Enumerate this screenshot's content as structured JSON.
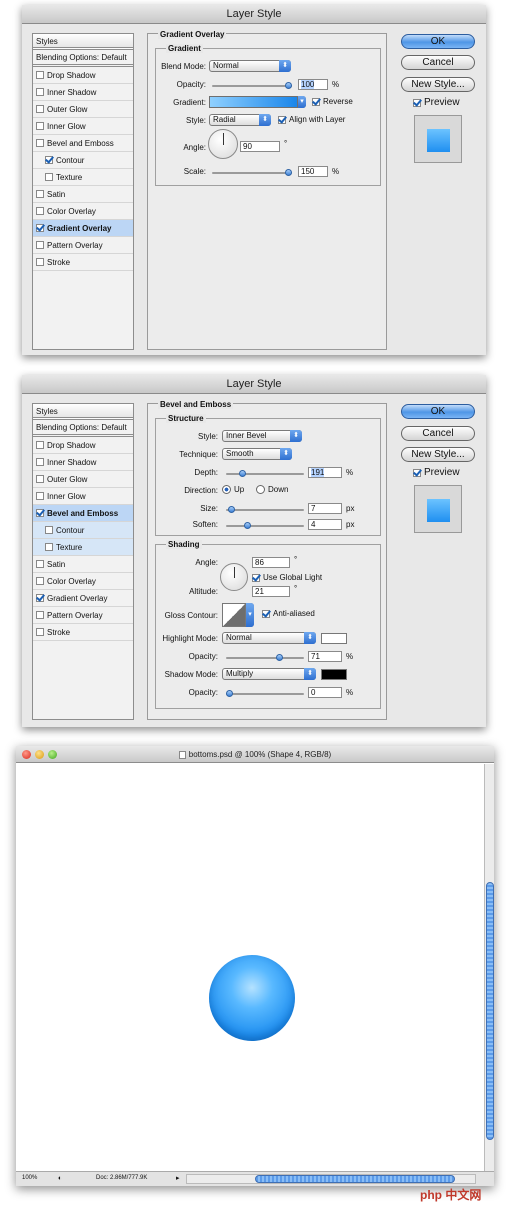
{
  "dialog1": {
    "title": "Layer Style",
    "styles_header": "Styles",
    "styles": [
      {
        "label": "Blending Options: Default",
        "checkbox": false,
        "checked": false,
        "indent": false,
        "selected": false
      },
      {
        "label": "Drop Shadow",
        "checkbox": true,
        "checked": false,
        "indent": false,
        "selected": false
      },
      {
        "label": "Inner Shadow",
        "checkbox": true,
        "checked": false,
        "indent": false,
        "selected": false
      },
      {
        "label": "Outer Glow",
        "checkbox": true,
        "checked": false,
        "indent": false,
        "selected": false
      },
      {
        "label": "Inner Glow",
        "checkbox": true,
        "checked": false,
        "indent": false,
        "selected": false
      },
      {
        "label": "Bevel and Emboss",
        "checkbox": true,
        "checked": false,
        "indent": false,
        "selected": false
      },
      {
        "label": "Contour",
        "checkbox": true,
        "checked": true,
        "indent": true,
        "selected": false
      },
      {
        "label": "Texture",
        "checkbox": true,
        "checked": false,
        "indent": true,
        "selected": false
      },
      {
        "label": "Satin",
        "checkbox": true,
        "checked": false,
        "indent": false,
        "selected": false
      },
      {
        "label": "Color Overlay",
        "checkbox": true,
        "checked": false,
        "indent": false,
        "selected": false
      },
      {
        "label": "Gradient Overlay",
        "checkbox": true,
        "checked": true,
        "indent": false,
        "selected": true
      },
      {
        "label": "Pattern Overlay",
        "checkbox": true,
        "checked": false,
        "indent": false,
        "selected": false
      },
      {
        "label": "Stroke",
        "checkbox": true,
        "checked": false,
        "indent": false,
        "selected": false
      }
    ],
    "section_title": "Gradient Overlay",
    "group_title": "Gradient",
    "blend_mode_label": "Blend Mode:",
    "blend_mode": "Normal",
    "opacity_label": "Opacity:",
    "opacity": "100",
    "opacity_unit": "%",
    "opacity_level": 1.0,
    "gradient_label": "Gradient:",
    "reverse_label": "Reverse",
    "reverse_checked": true,
    "style_label": "Style:",
    "style": "Radial",
    "align_label": "Align with Layer",
    "align_checked": true,
    "angle_label": "Angle:",
    "angle": "90",
    "degree": "°",
    "scale_label": "Scale:",
    "scale": "150",
    "scale_unit": "%",
    "scale_level": 1.0,
    "gradient_start": "#8fd0ff",
    "gradient_end": "#1a86ea"
  },
  "dialog2": {
    "title": "Layer Style",
    "styles_header": "Styles",
    "styles": [
      {
        "label": "Blending Options: Default",
        "checkbox": false,
        "checked": false,
        "indent": false,
        "selected": false
      },
      {
        "label": "Drop Shadow",
        "checkbox": true,
        "checked": false,
        "indent": false,
        "selected": false
      },
      {
        "label": "Inner Shadow",
        "checkbox": true,
        "checked": false,
        "indent": false,
        "selected": false
      },
      {
        "label": "Outer Glow",
        "checkbox": true,
        "checked": false,
        "indent": false,
        "selected": false
      },
      {
        "label": "Inner Glow",
        "checkbox": true,
        "checked": false,
        "indent": false,
        "selected": false
      },
      {
        "label": "Bevel and Emboss",
        "checkbox": true,
        "checked": true,
        "indent": false,
        "selected": true
      },
      {
        "label": "Contour",
        "checkbox": true,
        "checked": false,
        "indent": true,
        "selected": "sub"
      },
      {
        "label": "Texture",
        "checkbox": true,
        "checked": false,
        "indent": true,
        "selected": "sub"
      },
      {
        "label": "Satin",
        "checkbox": true,
        "checked": false,
        "indent": false,
        "selected": false
      },
      {
        "label": "Color Overlay",
        "checkbox": true,
        "checked": false,
        "indent": false,
        "selected": false
      },
      {
        "label": "Gradient Overlay",
        "checkbox": true,
        "checked": true,
        "indent": false,
        "selected": false
      },
      {
        "label": "Pattern Overlay",
        "checkbox": true,
        "checked": false,
        "indent": false,
        "selected": false
      },
      {
        "label": "Stroke",
        "checkbox": true,
        "checked": false,
        "indent": false,
        "selected": false
      }
    ],
    "section_title": "Bevel and Emboss",
    "structure_title": "Structure",
    "style_label": "Style:",
    "style": "Inner Bevel",
    "technique_label": "Technique:",
    "technique": "Smooth",
    "depth_label": "Depth:",
    "depth": "191",
    "depth_unit": "%",
    "depth_level": 0.19,
    "direction_label": "Direction:",
    "direction_up": "Up",
    "direction_down": "Down",
    "size_label": "Size:",
    "size": "7",
    "size_unit": "px",
    "size_level": 0.03,
    "soften_label": "Soften:",
    "soften": "4",
    "soften_unit": "px",
    "soften_level": 0.25,
    "shading_title": "Shading",
    "angle_label": "Angle:",
    "angle": "86",
    "degree": "°",
    "global_light_label": "Use Global Light",
    "altitude_label": "Altitude:",
    "altitude": "21",
    "gloss_label": "Gloss Contour:",
    "antialias_label": "Anti-aliased",
    "highlight_label": "Highlight Mode:",
    "highlight_mode": "Normal",
    "highlight_color": "#ffffff",
    "h_opacity_label": "Opacity:",
    "h_opacity": "71",
    "h_opacity_unit": "%",
    "h_opacity_level": 0.71,
    "shadow_label": "Shadow Mode:",
    "shadow_mode": "Multiply",
    "shadow_color": "#000000",
    "s_opacity_label": "Opacity:",
    "s_opacity": "0",
    "s_opacity_unit": "%",
    "s_opacity_level": 0.0
  },
  "buttons": {
    "ok": "OK",
    "cancel": "Cancel",
    "new_style": "New Style...",
    "preview": "Preview"
  },
  "document": {
    "title": "bottoms.psd @ 100% (Shape 4, RGB/8)",
    "zoom": "100%",
    "doc_info": "Doc: 2.86M/777.9K",
    "sphere_color": "#1f8ff0"
  },
  "watermark": "php 中文网"
}
